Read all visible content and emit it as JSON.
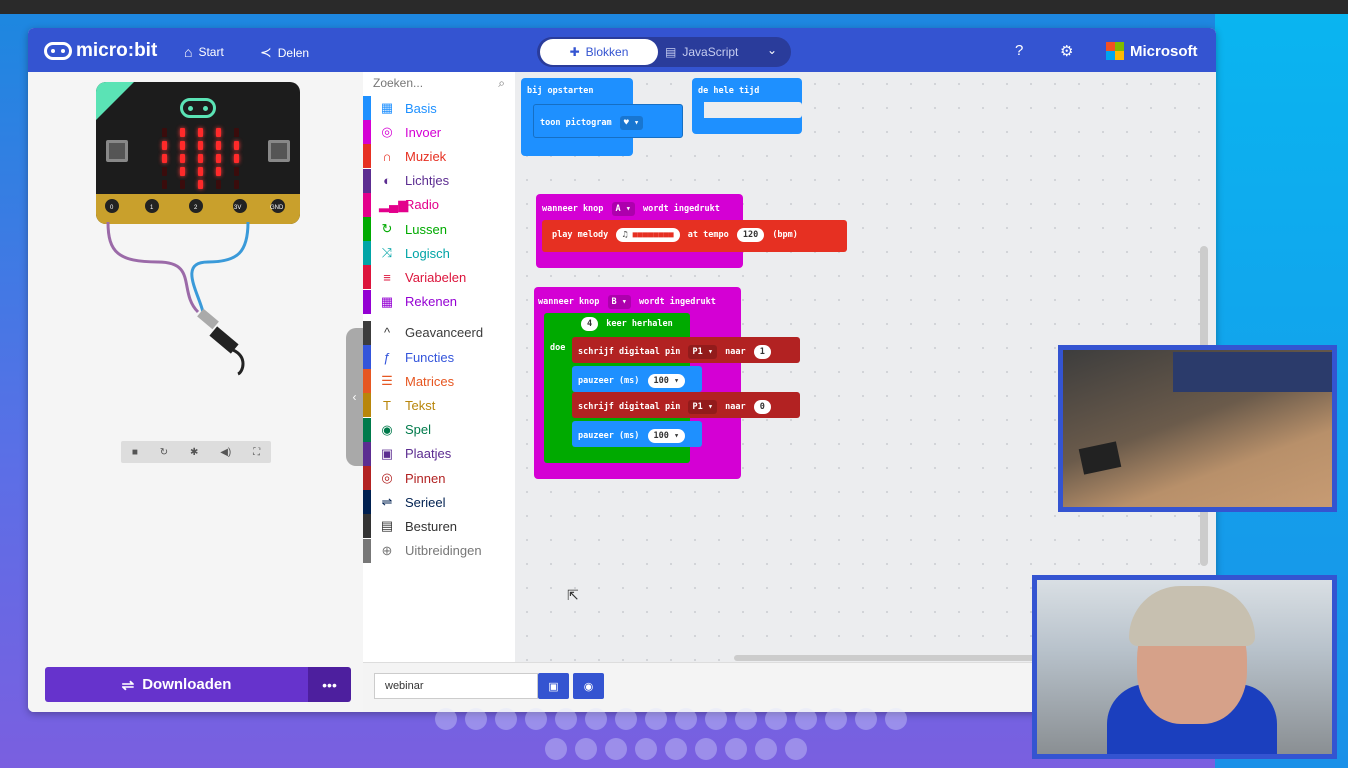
{
  "app": {
    "logo_text": "micro:bit",
    "nav": {
      "start": "Start",
      "share": "Delen"
    },
    "editor_toggle": {
      "blocks": "Blokken",
      "javascript": "JavaScript"
    },
    "brand": "Microsoft"
  },
  "simulator": {
    "pin_labels": [
      "0",
      "1",
      "2",
      "3V",
      "GND"
    ],
    "download_label": "Downloaden",
    "more_label": "•••"
  },
  "toolbox": {
    "search_placeholder": "Zoeken...",
    "categories": [
      {
        "label": "Basis",
        "color": "#1e90ff",
        "icon": "grid-icon"
      },
      {
        "label": "Invoer",
        "color": "#d400d4",
        "icon": "target-icon"
      },
      {
        "label": "Muziek",
        "color": "#e63022",
        "icon": "headphones-icon"
      },
      {
        "label": "Lichtjes",
        "color": "#5c2d91",
        "icon": "toggle-icon"
      },
      {
        "label": "Radio",
        "color": "#e3008c",
        "icon": "signal-icon"
      },
      {
        "label": "Lussen",
        "color": "#00aa00",
        "icon": "loop-icon"
      },
      {
        "label": "Logisch",
        "color": "#00a4a6",
        "icon": "shuffle-icon"
      },
      {
        "label": "Variabelen",
        "color": "#dc143c",
        "icon": "lines-icon"
      },
      {
        "label": "Rekenen",
        "color": "#9400d3",
        "icon": "calculator-icon"
      },
      {
        "label": "Geavanceerd",
        "color": "#3c3c3c",
        "icon": "chevron-up-icon"
      },
      {
        "label": "Functies",
        "color": "#3455db",
        "icon": "function-icon"
      },
      {
        "label": "Matrices",
        "color": "#e65722",
        "icon": "list-icon"
      },
      {
        "label": "Tekst",
        "color": "#b8860b",
        "icon": "text-icon"
      },
      {
        "label": "Spel",
        "color": "#007a4b",
        "icon": "gamepad-icon"
      },
      {
        "label": "Plaatjes",
        "color": "#5c2d91",
        "icon": "image-icon"
      },
      {
        "label": "Pinnen",
        "color": "#b22222",
        "icon": "pin-icon"
      },
      {
        "label": "Serieel",
        "color": "#002050",
        "icon": "usb-icon"
      },
      {
        "label": "Besturen",
        "color": "#333333",
        "icon": "control-icon"
      },
      {
        "label": "Uitbreidingen",
        "color": "#777777",
        "icon": "plus-icon"
      }
    ]
  },
  "workspace": {
    "on_start": {
      "title": "bij opstarten",
      "show_icon": "toon pictogram"
    },
    "forever": {
      "title": "de hele tijd"
    },
    "button_a": {
      "when": "wanneer knop",
      "button": "A",
      "pressed": "wordt ingedrukt",
      "play": "play melody",
      "tempo_label": "at tempo",
      "tempo": "120",
      "bpm": "(bpm)"
    },
    "button_b": {
      "when": "wanneer knop",
      "button": "B",
      "pressed": "wordt ingedrukt",
      "repeat_count": "4",
      "repeat_label": "keer herhalen",
      "do_label": "doe",
      "write1": {
        "label": "schrijf digitaal pin",
        "pin": "P1",
        "to": "naar",
        "value": "1"
      },
      "pause1": {
        "label": "pauzeer (ms)",
        "value": "100"
      },
      "write2": {
        "label": "schrijf digitaal pin",
        "pin": "P1",
        "to": "naar",
        "value": "0"
      },
      "pause2": {
        "label": "pauzeer (ms)",
        "value": "100"
      }
    }
  },
  "bottom": {
    "project_name": "webinar"
  }
}
